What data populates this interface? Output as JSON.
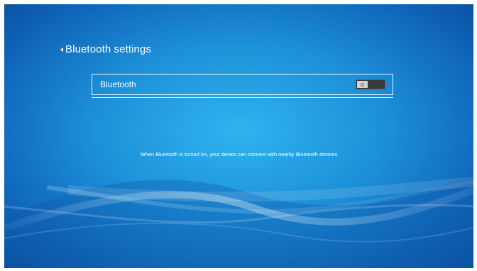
{
  "header": {
    "title": "Bluetooth settings",
    "back_icon": "chevron-left-icon"
  },
  "settings": {
    "bluetooth": {
      "label": "Bluetooth",
      "enabled": false
    }
  },
  "info": {
    "description": "When Bluetooth is turned on, your device can connect with nearby Bluetooth devices"
  },
  "colors": {
    "background_center": "#2fb4ee",
    "background_edge": "#0b4e9e",
    "toggle_track": "#3a3a3a",
    "toggle_thumb": "#d0d3d6",
    "text": "#ffffff"
  }
}
